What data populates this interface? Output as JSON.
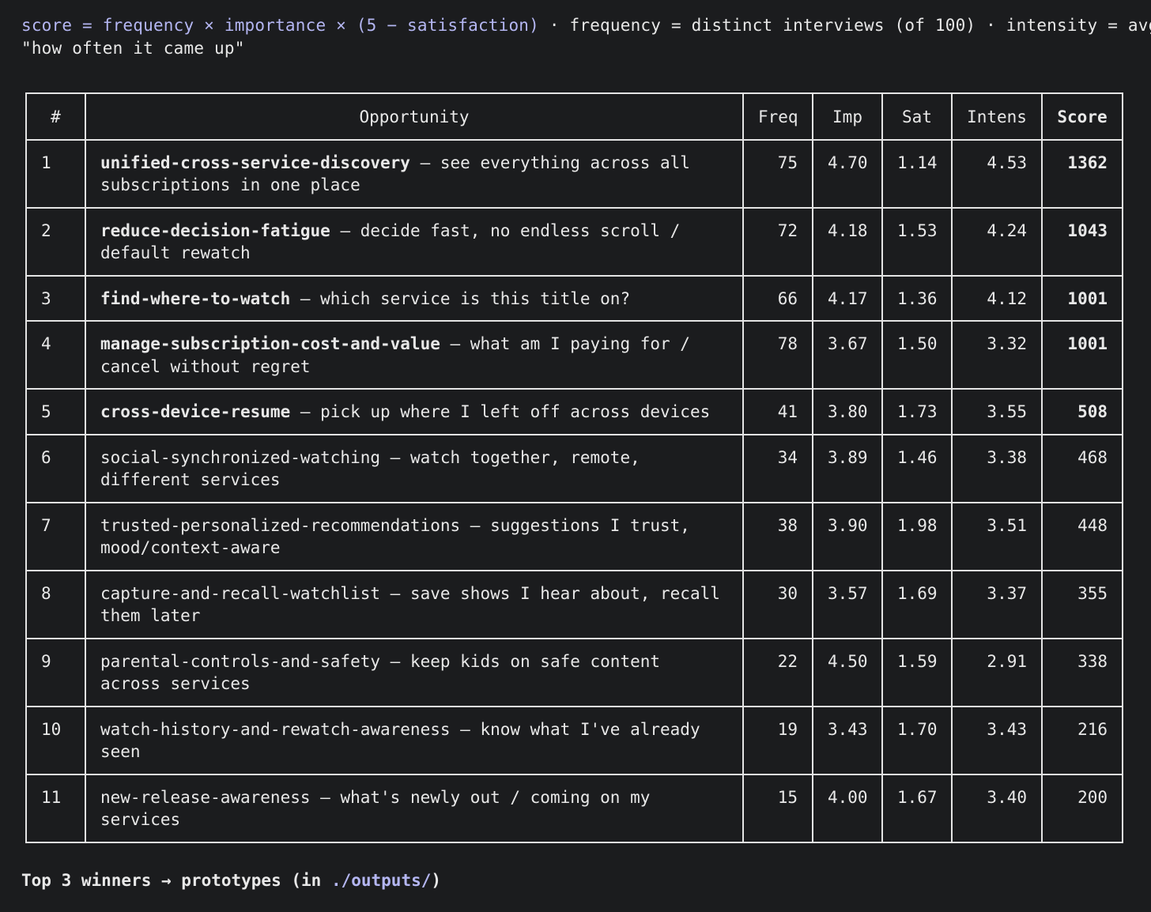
{
  "header": {
    "formula_code": "score = frequency × importance × (5 − satisfaction)",
    "sep1": " · ",
    "freq_def": "frequency = distinct interviews (of 100)",
    "sep2": " · ",
    "intensity_def": "intensity = avg",
    "line2": "\"how often it came up\""
  },
  "table": {
    "columns": [
      "#",
      "Opportunity",
      "Freq",
      "Imp",
      "Sat",
      "Intens",
      "Score"
    ],
    "rows": [
      {
        "idx": "1",
        "name": "unified-cross-service-discovery",
        "desc": " — see everything across all subscriptions in one place",
        "freq": "75",
        "imp": "4.70",
        "sat": "1.14",
        "intens": "4.53",
        "score": "1362",
        "highlight": true
      },
      {
        "idx": "2",
        "name": "reduce-decision-fatigue",
        "desc": " — decide fast, no endless scroll / default rewatch",
        "freq": "72",
        "imp": "4.18",
        "sat": "1.53",
        "intens": "4.24",
        "score": "1043",
        "highlight": true
      },
      {
        "idx": "3",
        "name": "find-where-to-watch",
        "desc": " — which service is this title on?",
        "freq": "66",
        "imp": "4.17",
        "sat": "1.36",
        "intens": "4.12",
        "score": "1001",
        "highlight": true
      },
      {
        "idx": "4",
        "name": "manage-subscription-cost-and-value",
        "desc": " — what am I paying for / cancel without regret",
        "freq": "78",
        "imp": "3.67",
        "sat": "1.50",
        "intens": "3.32",
        "score": "1001",
        "highlight": true
      },
      {
        "idx": "5",
        "name": "cross-device-resume",
        "desc": " — pick up where I left off across devices",
        "freq": "41",
        "imp": "3.80",
        "sat": "1.73",
        "intens": "3.55",
        "score": "508",
        "highlight": true
      },
      {
        "idx": "6",
        "name": "social-synchronized-watching",
        "desc": " — watch together, remote, different services",
        "freq": "34",
        "imp": "3.89",
        "sat": "1.46",
        "intens": "3.38",
        "score": "468",
        "highlight": false
      },
      {
        "idx": "7",
        "name": "trusted-personalized-recommendations",
        "desc": " — suggestions I trust, mood/context-aware",
        "freq": "38",
        "imp": "3.90",
        "sat": "1.98",
        "intens": "3.51",
        "score": "448",
        "highlight": false
      },
      {
        "idx": "8",
        "name": "capture-and-recall-watchlist",
        "desc": " — save shows I hear about, recall them later",
        "freq": "30",
        "imp": "3.57",
        "sat": "1.69",
        "intens": "3.37",
        "score": "355",
        "highlight": false
      },
      {
        "idx": "9",
        "name": "parental-controls-and-safety",
        "desc": " — keep kids on safe content across  services",
        "freq": "22",
        "imp": "4.50",
        "sat": "1.59",
        "intens": "2.91",
        "score": "338",
        "highlight": false
      },
      {
        "idx": "10",
        "name": "watch-history-and-rewatch-awareness",
        "desc": " — know what I've already seen",
        "freq": "19",
        "imp": "3.43",
        "sat": "1.70",
        "intens": "3.43",
        "score": "216",
        "highlight": false
      },
      {
        "idx": "11",
        "name": "new-release-awareness",
        "desc": " — what's newly out / coming on my services",
        "freq": "15",
        "imp": "4.00",
        "sat": "1.67",
        "intens": "3.40",
        "score": "200",
        "highlight": false
      }
    ]
  },
  "footer": {
    "prefix": "Top 3 winners → prototypes (in ",
    "path": "./outputs/",
    "suffix": ")"
  }
}
